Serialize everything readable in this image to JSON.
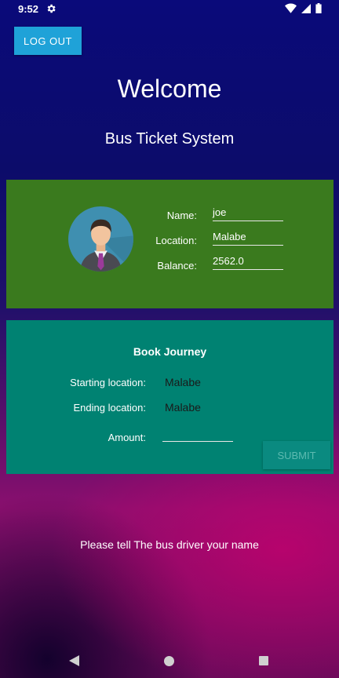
{
  "status_bar": {
    "time": "9:52"
  },
  "header": {
    "logout_label": "LOG OUT",
    "welcome": "Welcome",
    "subtitle": "Bus Ticket System"
  },
  "profile": {
    "name_label": "Name:",
    "name_value": "joe",
    "location_label": "Location:",
    "location_value": "Malabe",
    "balance_label": "Balance:",
    "balance_value": "2562.0"
  },
  "journey": {
    "title": "Book Journey",
    "start_label": "Starting location:",
    "start_value": "Malabe",
    "end_label": "Ending location:",
    "end_value": "Malabe",
    "amount_label": "Amount:",
    "amount_value": "",
    "submit_label": "SUBMIT"
  },
  "message": "Please tell The bus driver your name",
  "colors": {
    "profile_card": "#3a7a1e",
    "journey_card": "#008272",
    "logout_button": "#1fa2d8"
  }
}
